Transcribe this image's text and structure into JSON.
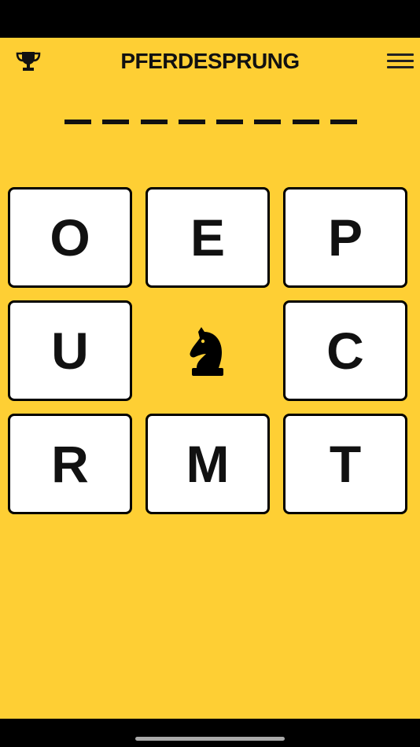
{
  "header": {
    "title": "PFERDESPRUNG",
    "left_icon": "trophy-icon",
    "right_icon": "hamburger-menu-icon"
  },
  "answer": {
    "slots": 8,
    "filled": ""
  },
  "grid": {
    "tiles": [
      {
        "letter": "O"
      },
      {
        "letter": "E"
      },
      {
        "letter": "P"
      },
      {
        "letter": "U"
      },
      {
        "letter": "C"
      },
      {
        "letter": "R"
      },
      {
        "letter": "M"
      },
      {
        "letter": "T"
      }
    ],
    "center_icon": "chess-knight-icon"
  },
  "colors": {
    "background": "#fecf34",
    "tile": "#ffffff",
    "border": "#000000",
    "text": "#111111"
  }
}
